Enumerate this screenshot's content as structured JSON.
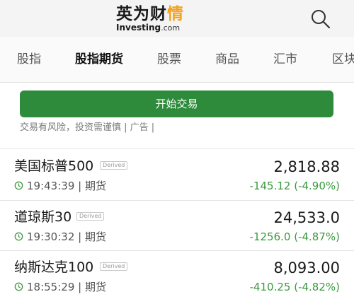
{
  "header": {
    "logo_cn_main": "英为财",
    "logo_cn_accent": "情",
    "logo_en": "Investing",
    "logo_domain": ".com",
    "search_icon": "search-icon"
  },
  "tabs": [
    {
      "label": "股指",
      "active": false
    },
    {
      "label": "股指期货",
      "active": true
    },
    {
      "label": "股票",
      "active": false
    },
    {
      "label": "商品",
      "active": false
    },
    {
      "label": "汇市",
      "active": false
    },
    {
      "label": "区块",
      "active": false
    }
  ],
  "trade_button": {
    "label": "开始交易"
  },
  "risk_notice": "交易有风险，投资需谨慎 | 广告 |",
  "quotes": [
    {
      "name": "美国标普500",
      "badge": "Derived",
      "time": "19:43:39",
      "sep": "|",
      "type": "期货",
      "price": "2,818.88",
      "change": "-145.12 (-4.90%)"
    },
    {
      "name": "道琼斯30",
      "badge": "Derived",
      "time": "19:30:32",
      "sep": "|",
      "type": "期货",
      "price": "24,533.0",
      "change": "-1256.0 (-4.87%)"
    },
    {
      "name": "纳斯达克100",
      "badge": "Derived",
      "time": "18:55:29",
      "sep": "|",
      "type": "期货",
      "price": "8,093.00",
      "change": "-410.25 (-4.82%)"
    }
  ],
  "colors": {
    "accent_green": "#2e8b3c",
    "change_green": "#3a9a3f",
    "logo_orange": "#f4a21b"
  }
}
